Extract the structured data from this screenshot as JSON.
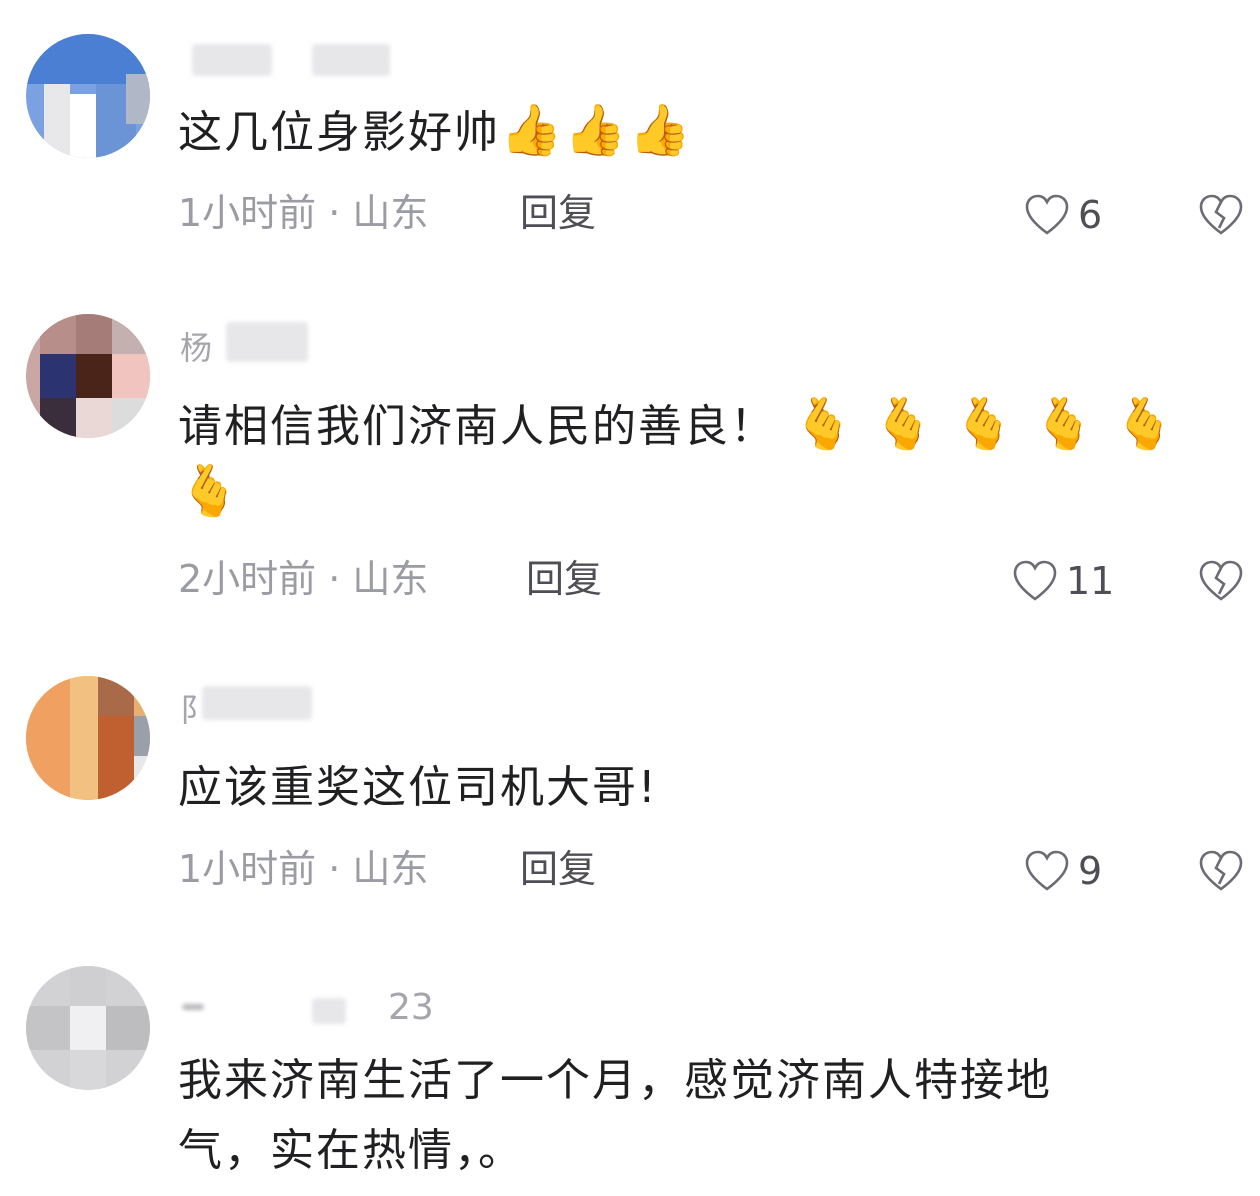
{
  "comments": [
    {
      "user_fragment": "",
      "text": "这几位身影好帅",
      "emoji": "👍👍👍",
      "time": "1小时前 · 山东",
      "reply_label": "回复",
      "likes": "6"
    },
    {
      "user_fragment": "杨",
      "text": "请相信我们济南人民的善良！",
      "emoji_line1": "🫰🫰🫰🫰🫰",
      "emoji_line2": "🫰",
      "time": "2小时前 · 山东",
      "reply_label": "回复",
      "likes": "11"
    },
    {
      "user_fragment": "阝",
      "text": "应该重奖这位司机大哥!",
      "time": "1小时前 · 山东",
      "reply_label": "回复",
      "likes": "9"
    },
    {
      "user_fragment": "23",
      "text_line1": "我来济南生活了一个月，感觉济南人特接地",
      "text_line2": "气，实在热情，。"
    }
  ],
  "icons": {
    "like": "heart-outline-icon",
    "dislike": "broken-heart-icon"
  },
  "colors": {
    "text": "#202022",
    "meta": "#9b9ba4",
    "reply": "#4e4e56"
  }
}
